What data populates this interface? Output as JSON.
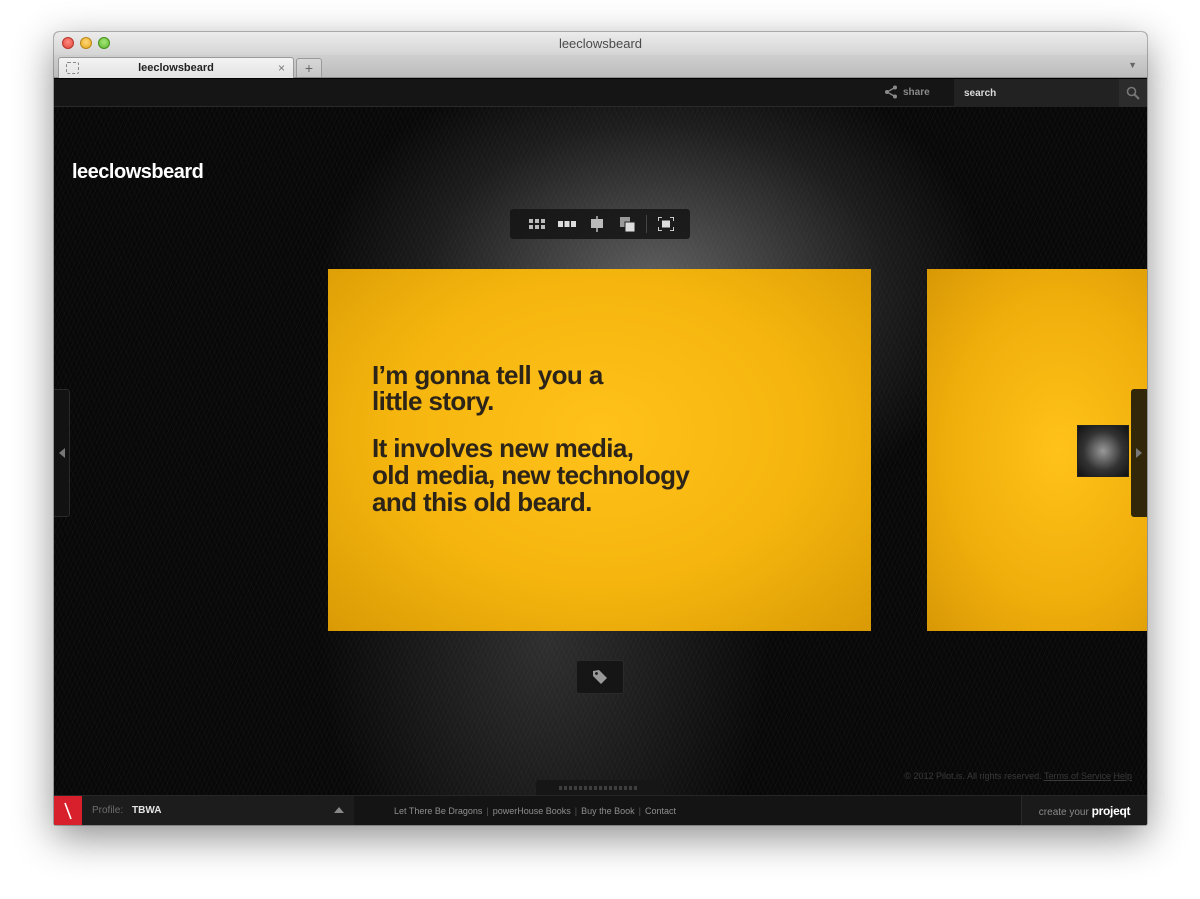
{
  "window": {
    "title": "leeclowsbeard"
  },
  "tabs": [
    {
      "label": "leeclowsbeard",
      "close": "×"
    }
  ],
  "newtab_symbol": "+",
  "topbar": {
    "share_label": "share",
    "search_placeholder": "search"
  },
  "site": {
    "title": "leeclowsbeard"
  },
  "view_toolbar": {
    "buttons": [
      "grid-view-icon",
      "filmstrip-view-icon",
      "presentation-view-icon",
      "stack-view-icon",
      "fullscreen-icon"
    ]
  },
  "slide": {
    "lines": [
      "I’m gonna tell you a",
      "little story.",
      "It involves new media,",
      "old media, new technology",
      "and this old beard."
    ],
    "background_color": "#f5b50e",
    "text_color": "#2c2418"
  },
  "footer": {
    "copyright": "© 2012 Pilot.is. All rights reserved.",
    "terms": "Terms of Service",
    "help": "Help"
  },
  "bottombar": {
    "profile_label": "Profile:",
    "profile_name": "TBWA",
    "links": [
      "Let There Be Dragons",
      "powerHouse Books",
      "Buy the Book",
      "Contact"
    ],
    "link_separator": "|",
    "create_prefix": "create your",
    "create_brand": "projeqt"
  },
  "colors": {
    "logo_red": "#d8202c",
    "accent_yellow": "#f5b50e"
  }
}
